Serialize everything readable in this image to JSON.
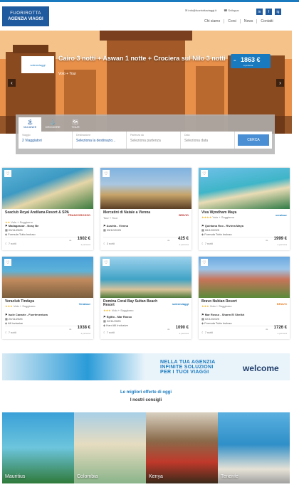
{
  "header": {
    "logo_line1": "FUORIROTTA",
    "logo_line2": "AGENZIA VIAGGI",
    "email": "info@fuorirottaviaggi.it",
    "phone": "Sviluppo",
    "socials": [
      "in",
      "f",
      "ig"
    ],
    "nav": [
      "Chi siamo",
      "Corsi",
      "News",
      "Contatti"
    ]
  },
  "hero": {
    "badge": "solemviaggi",
    "title": "Cairo 3 notti + Aswan 1 notte + Crociera sul Nilo 3 notti",
    "subtitle": "Volo + Tour",
    "price_from": "da",
    "price": "1863 €",
    "price_per": "a persona",
    "prev": "‹",
    "next": "›"
  },
  "search": {
    "tabs": [
      {
        "label": "VACANZE",
        "icon": "🏝"
      },
      {
        "label": "CROCIERE",
        "icon": "⚓"
      },
      {
        "label": "TOUR",
        "icon": "🗺"
      }
    ],
    "fields": [
      {
        "label": "Viaggio",
        "value": "2 Viaggiatori"
      },
      {
        "label": "Destinazione",
        "value": "Seleziona la destinazio..."
      },
      {
        "label": "Partenza da",
        "value": "Seleziona partenza"
      },
      {
        "label": "Data",
        "value": "Seleziona data"
      }
    ],
    "button": "CERCA"
  },
  "offers": [
    {
      "title": "Seaclub Royal Andilana Resort & SPA",
      "brand": "FRANCOROSSO",
      "brand_color": "#c0392b",
      "sub": "Volo + Soggiorno",
      "stars": "★★",
      "dest": "Madagascar - Nosy Be",
      "date": "09/11/2025",
      "board": "Formula Tutto Incluso",
      "nights": "7 notti",
      "from": "da",
      "price": "1602 €",
      "pp": "a persona"
    },
    {
      "title": "Mercatini di Natale a Vienna",
      "brand": "BRIVIO",
      "brand_color": "#b33",
      "sub": "Tour + Tour",
      "stars": "",
      "dest": "Austria - Vienna",
      "date": "05/12/2025",
      "board": "",
      "nights": "3 notti",
      "from": "da",
      "price": "425 €",
      "pp": "a persona"
    },
    {
      "title": "Viva Wyndham Maya",
      "brand": "veratour",
      "brand_color": "#1a7abf",
      "sub": "Volo + Soggiorno",
      "stars": "★★★★",
      "dest": "Quintana Roo - Riviera Maya",
      "date": "06/12/2025",
      "board": "Formula Tutto Incluso",
      "nights": "7 notti",
      "from": "da",
      "price": "1999 €",
      "pp": "a persona"
    },
    {
      "title": "Veraclub Tindaya",
      "brand": "Veratour",
      "brand_color": "#1a7abf",
      "sub": "Volo + Soggiorno",
      "stars": "★★★",
      "dest": "Isole Canarie - Fuerteventura",
      "date": "20/11/2025",
      "board": "All Inclusive",
      "nights": "7 notti",
      "from": "da",
      "price": "1038 €",
      "pp": "a persona"
    },
    {
      "title": "Domina Coral Bay Sultan Beach Resort",
      "brand": "solemviaggi",
      "brand_color": "#1a7abf",
      "sub": "Volo + Soggiorno",
      "stars": "★★★",
      "dest": "Egitto - Mar Rosso",
      "date": "22/11/2025",
      "board": "Hard All Inclusive",
      "nights": "7 notti",
      "from": "da",
      "price": "1090 €",
      "pp": "a persona"
    },
    {
      "title": "Bravo Nubian Resort",
      "brand": "BRAVO",
      "brand_color": "#e67e22",
      "sub": "Volo + Soggiorno",
      "stars": "★★★",
      "dest": "Mar Rosso - Sharm El Sheikh",
      "date": "02/12/2025",
      "board": "Formula Tutto Incluso",
      "nights": "7 notti",
      "from": "da",
      "price": "1726 €",
      "pp": "a persona"
    }
  ],
  "banner": {
    "line1": "NELLA TUA AGENZIA",
    "line2": "INFINITE SOLUZIONI",
    "line3": "PER I TUOI VIAGGI",
    "brand": "welcome"
  },
  "sections": {
    "best_offers": "Le migliori offerte di oggi",
    "advice": "I nostri consigli"
  },
  "destinations": [
    "Mauritius",
    "Colombia",
    "Kenya",
    "Tenerife"
  ]
}
